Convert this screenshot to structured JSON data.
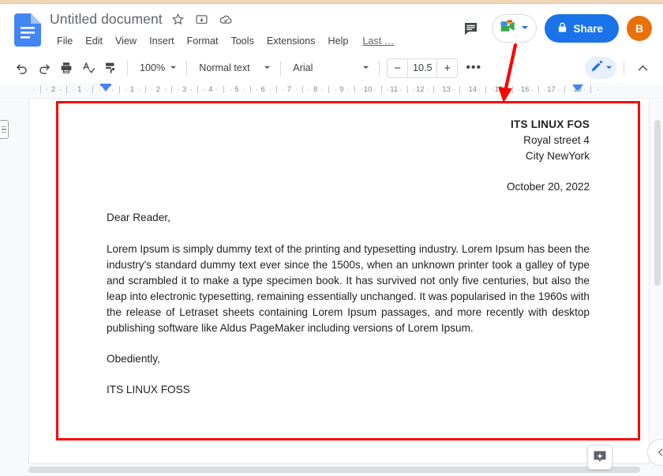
{
  "app": {
    "name": "Google Docs",
    "logo_icon": "google-docs-logo-icon"
  },
  "header": {
    "doc_title": "Untitled document",
    "title_icons": [
      {
        "name": "star-icon",
        "glyph": "☆"
      },
      {
        "name": "move-to-folder-icon",
        "glyph": "❐"
      },
      {
        "name": "saved-to-drive-cloud-icon",
        "glyph": "☁"
      }
    ],
    "menus": [
      "File",
      "Edit",
      "View",
      "Insert",
      "Format",
      "Tools",
      "Extensions",
      "Help"
    ],
    "last_edit": "Last …",
    "comment_history_icon": "comment-history-icon",
    "meet_chip": {
      "icon": "google-meet-camera-icon",
      "caret": "▼"
    },
    "share": {
      "label": "Share",
      "lock_icon": "lock-icon",
      "color": "#1a73e8"
    },
    "avatar": {
      "initial": "B",
      "color": "#e8710a"
    }
  },
  "toolbar": {
    "undo_icon": "undo-icon",
    "redo_icon": "redo-icon",
    "print_icon": "print-icon",
    "spellcheck_icon": "spellcheck-icon",
    "paint_format_icon": "paint-format-icon",
    "zoom_value": "100%",
    "paragraph_style": "Normal text",
    "font_family": "Arial",
    "font_size": "10.5",
    "decrease_font_label": "−",
    "increase_font_label": "+",
    "more_options_label": "•••",
    "caret": "▾",
    "edit_mode_icon": "pencil-edit-mode-icon",
    "hide_menus_icon": "chevron-up-icon"
  },
  "ruler": {
    "numbers": [
      "2",
      "1",
      "1",
      "2",
      "3",
      "4",
      "5",
      "6",
      "7",
      "8",
      "9",
      "10",
      "11",
      "12",
      "13",
      "14",
      "15",
      "16",
      "17",
      "18"
    ],
    "left_indent_marker": "left-indent-marker",
    "right_indent_marker": "right-indent-marker"
  },
  "document": {
    "sender_name": "ITS LINUX FOS",
    "sender_street": "Royal street 4",
    "sender_city": "City NewYork",
    "date": "October 20, 2022",
    "salutation": "Dear Reader,",
    "body": "Lorem Ipsum is simply dummy text of the printing and typesetting industry. Lorem Ipsum has been the industry's standard dummy text ever since the 1500s, when an unknown printer took a galley of type and scrambled it to make a type specimen book. It has survived not only five centuries, but also the leap into electronic typesetting, remaining essentially unchanged. It was popularised in the 1960s with the release of Letraset sheets containing Lorem Ipsum passages, and more recently with desktop publishing software like Aldus PageMaker including versions of Lorem Ipsum.",
    "closing": "Obediently,",
    "signature": "ITS LINUX FOSS"
  },
  "overlays": {
    "left_rail_toggle_icon": "document-outline-toggle-icon",
    "explore_button_icon": "explore-sparkle-icon",
    "side_panel_collapse_icon": "chevron-left-icon",
    "vertical_scrollbar": "vertical-scrollbar",
    "horizontal_scrollbar": "horizontal-scrollbar"
  },
  "annotations": {
    "highlight_color": "#fc0404",
    "rectangle": "red-highlight-rectangle-around-document",
    "arrow": "red-arrow-pointing-to-page-top-right"
  }
}
